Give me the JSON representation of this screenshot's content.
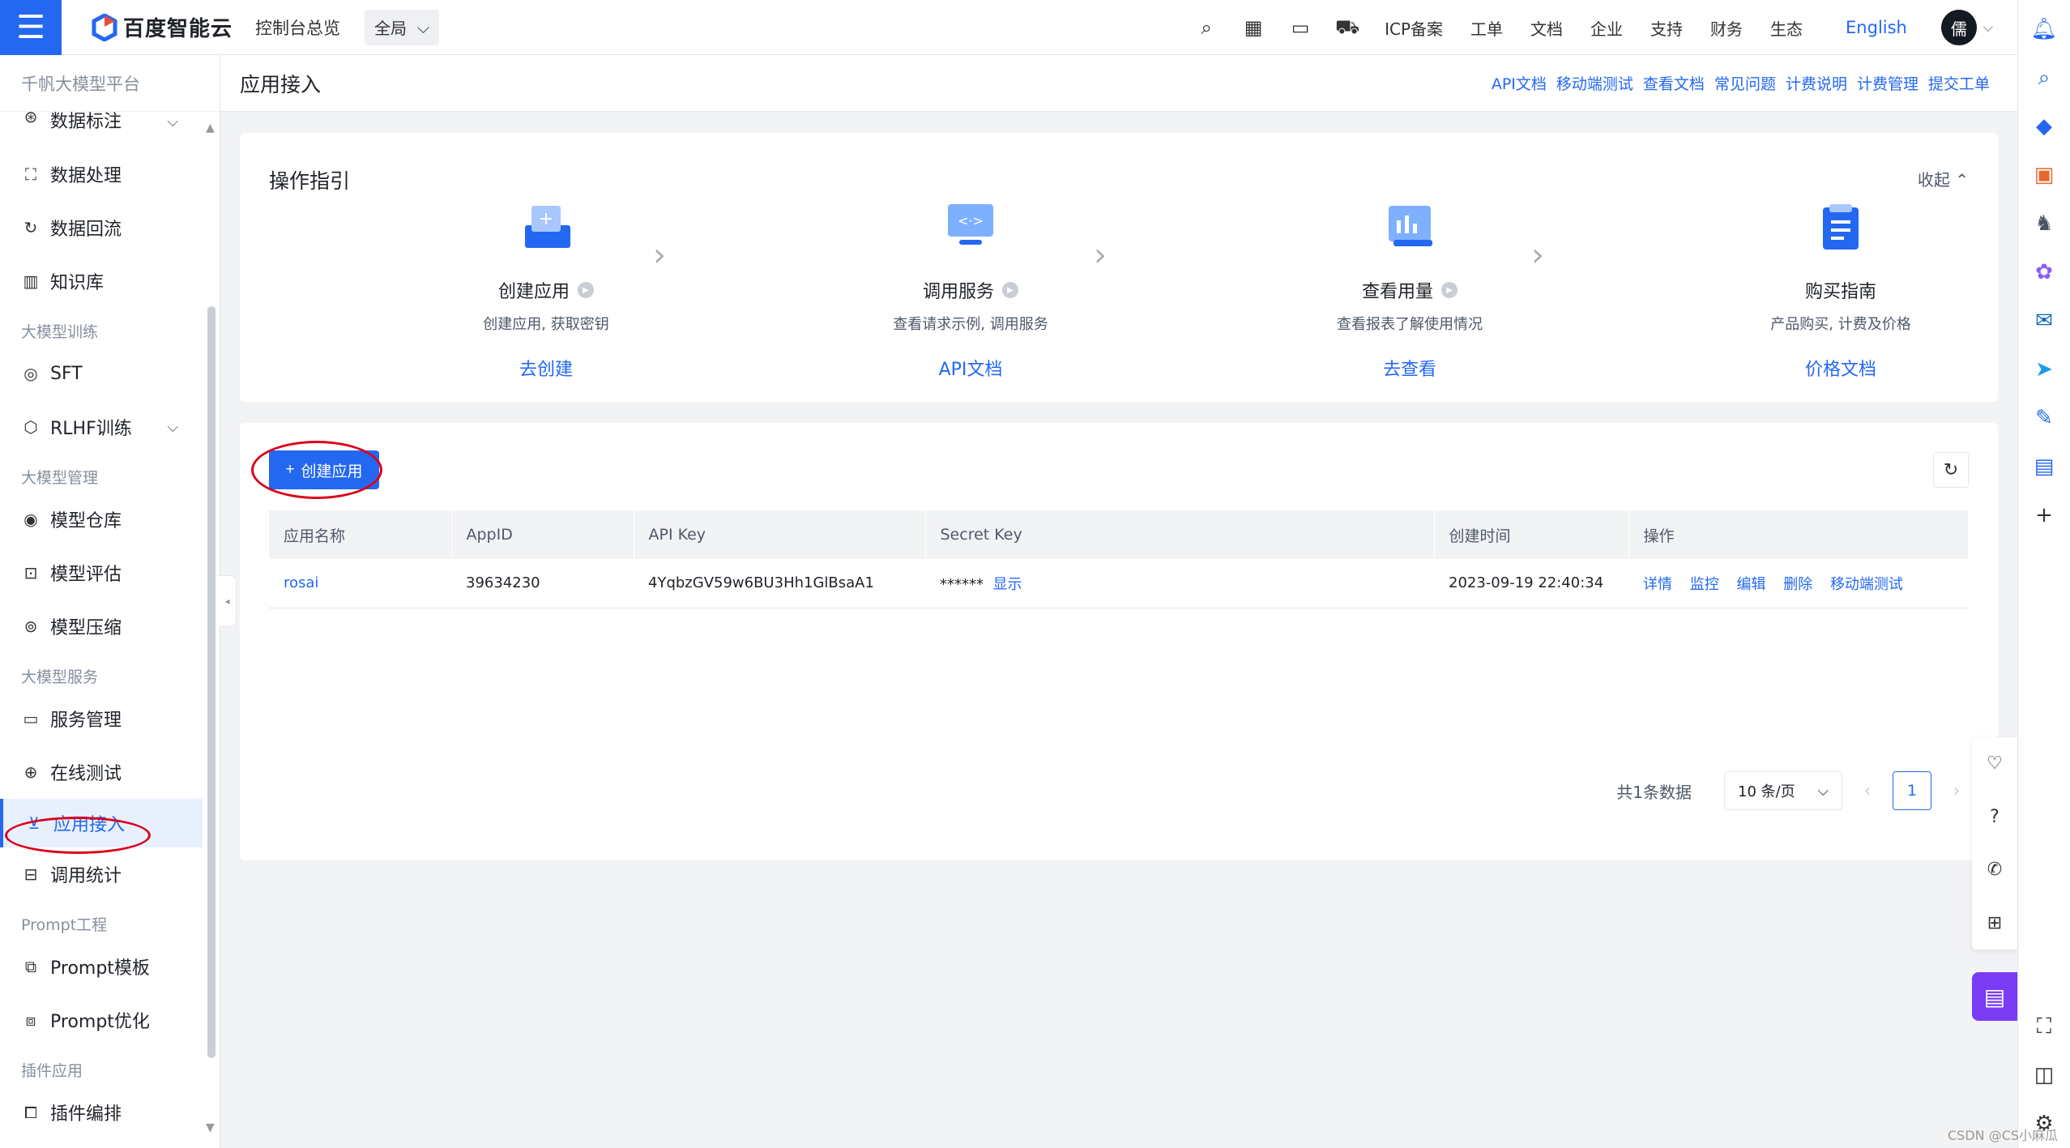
{
  "topbar": {
    "brand": "百度智能云",
    "console": "控制台总览",
    "scope": "全局",
    "nav": [
      "ICP备案",
      "工单",
      "文档",
      "企业",
      "支持",
      "财务",
      "生态"
    ],
    "lang": "English",
    "avatar": "儒"
  },
  "sidebar": {
    "title": "千帆大模型平台",
    "items_top": [
      "数据标注",
      "数据处理",
      "数据回流",
      "知识库"
    ],
    "group_train": "大模型训练",
    "sft": "SFT",
    "rlhf": "RLHF训练",
    "group_manage": "大模型管理",
    "manage_items": [
      "模型仓库",
      "模型评估",
      "模型压缩"
    ],
    "group_service": "大模型服务",
    "service_items": [
      "服务管理",
      "在线测试",
      "应用接入",
      "调用统计"
    ],
    "group_prompt": "Prompt工程",
    "prompt_items": [
      "Prompt模板",
      "Prompt优化"
    ],
    "group_plugin": "插件应用",
    "plugin_items": [
      "插件编排"
    ]
  },
  "page": {
    "title": "应用接入",
    "links": [
      "API文档",
      "移动端测试",
      "查看文档",
      "常见问题",
      "计费说明",
      "计费管理",
      "提交工单"
    ]
  },
  "guide": {
    "title": "操作指引",
    "collapse": "收起",
    "steps": [
      {
        "name": "创建应用",
        "desc": "创建应用, 获取密钥",
        "action": "去创建"
      },
      {
        "name": "调用服务",
        "desc": "查看请求示例, 调用服务",
        "action": "API文档"
      },
      {
        "name": "查看用量",
        "desc": "查看报表了解使用情况",
        "action": "去查看"
      },
      {
        "name": "购买指南",
        "desc": "产品购买, 计费及价格",
        "action": "价格文档"
      }
    ]
  },
  "table": {
    "create_label": "创建应用",
    "headers": [
      "应用名称",
      "AppID",
      "API Key",
      "Secret Key",
      "创建时间",
      "操作"
    ],
    "rows": [
      {
        "name": "rosai",
        "appid": "39634230",
        "apikey": "4YqbzGV59w6BU3Hh1GlBsaA1",
        "secret": "******",
        "show": "显示",
        "time": "2023-09-19 22:40:34",
        "ops": [
          "详情",
          "监控",
          "编辑",
          "删除",
          "移动端测试"
        ]
      }
    ]
  },
  "pager": {
    "total": "共1条数据",
    "size": "10 条/页",
    "page": "1"
  },
  "watermark": "CSDN @CS小麻瓜",
  "colors": {
    "accent": "#2468f2",
    "mark": "#d9001b",
    "chat": "#7a3cf5"
  }
}
